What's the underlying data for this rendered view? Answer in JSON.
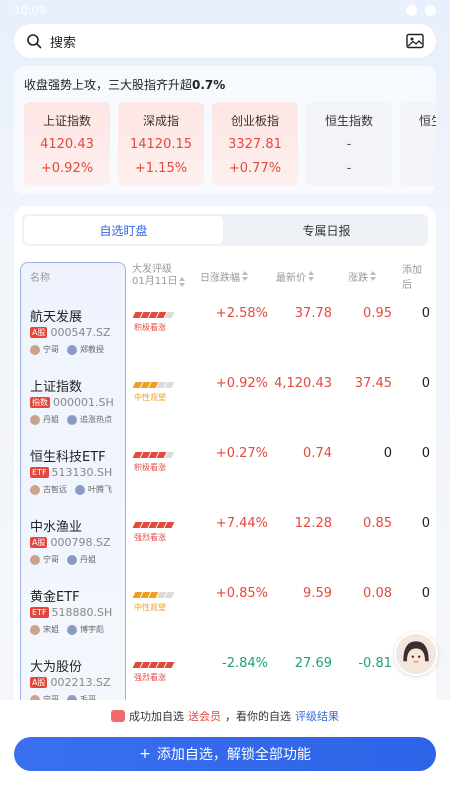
{
  "status_bar": {
    "time": "10:09"
  },
  "search": {
    "placeholder": "搜索"
  },
  "summary": {
    "headline_prefix": "收盘强势上攻，三大股指齐升超",
    "headline_value": "0.7%",
    "indices": [
      {
        "name": "上证指数",
        "value": "4120.43",
        "change": "+0.92%",
        "state": "up"
      },
      {
        "name": "深成指",
        "value": "14120.15",
        "change": "+1.15%",
        "state": "up"
      },
      {
        "name": "创业板指",
        "value": "3327.81",
        "change": "+0.77%",
        "state": "up"
      },
      {
        "name": "恒生指数",
        "value": "-",
        "change": "-",
        "state": "flat"
      },
      {
        "name": "恒生科技",
        "value": "-",
        "change": "-",
        "state": "flat"
      }
    ]
  },
  "tabs": [
    {
      "label": "自选盯盘",
      "active": true
    },
    {
      "label": "专属日报",
      "active": false
    }
  ],
  "table": {
    "headers": {
      "name": "名称",
      "rating_line1": "大发评级",
      "rating_line2": "01月11日",
      "intraday": "日涨跌幅",
      "price": "最新价",
      "change": "涨跌",
      "added": "添加后"
    },
    "rows": [
      {
        "name": "航天发展",
        "tag": "A股",
        "code": "000547.SZ",
        "p1": "宁哥",
        "p2": "郑教授",
        "rating": "积极看涨",
        "rating_color": "#e34a3e",
        "rating_level": 4,
        "pct": "+2.58%",
        "price": "37.78",
        "chg": "0.95",
        "added": "0",
        "dir": "up"
      },
      {
        "name": "上证指数",
        "tag": "指数",
        "code": "000001.SH",
        "p1": "丹姐",
        "p2": "追涨热点",
        "rating": "中性观望",
        "rating_color": "#f0a020",
        "rating_level": 3,
        "pct": "+0.92%",
        "price": "4,120.43",
        "chg": "37.45",
        "added": "0",
        "dir": "up"
      },
      {
        "name": "恒生科技ETF",
        "tag": "ETF",
        "code": "513130.SH",
        "p1": "古智远",
        "p2": "叶腾飞",
        "rating": "积极看涨",
        "rating_color": "#e34a3e",
        "rating_level": 4,
        "pct": "+0.27%",
        "price": "0.74",
        "chg": "0",
        "added": "0",
        "dir": "up"
      },
      {
        "name": "中水渔业",
        "tag": "A股",
        "code": "000798.SZ",
        "p1": "宁哥",
        "p2": "丹姐",
        "rating": "强烈看涨",
        "rating_color": "#e34a3e",
        "rating_level": 5,
        "pct": "+7.44%",
        "price": "12.28",
        "chg": "0.85",
        "added": "0",
        "dir": "up"
      },
      {
        "name": "黄金ETF",
        "tag": "ETF",
        "code": "518880.SH",
        "p1": "宋姐",
        "p2": "博宇彪",
        "rating": "中性观望",
        "rating_color": "#f0a020",
        "rating_level": 3,
        "pct": "+0.85%",
        "price": "9.59",
        "chg": "0.08",
        "added": "0",
        "dir": "up"
      },
      {
        "name": "大为股份",
        "tag": "A股",
        "code": "002213.SZ",
        "p1": "宁哥",
        "p2": "毛哥",
        "rating": "强烈看涨",
        "rating_color": "#e34a3e",
        "rating_level": 5,
        "pct": "-2.84%",
        "price": "27.69",
        "chg": "-0.81",
        "added": "0",
        "dir": "down"
      }
    ]
  },
  "promo": {
    "part1": "成功加自选",
    "part2": "送会员",
    "part3": "，看你的自选",
    "part4": "评级结果"
  },
  "cta": {
    "plus": "+",
    "label": "添加自选，解锁全部功能"
  },
  "colors": {
    "up": "#e34a3e",
    "down": "#1aa37a",
    "accent": "#2f6be6"
  }
}
